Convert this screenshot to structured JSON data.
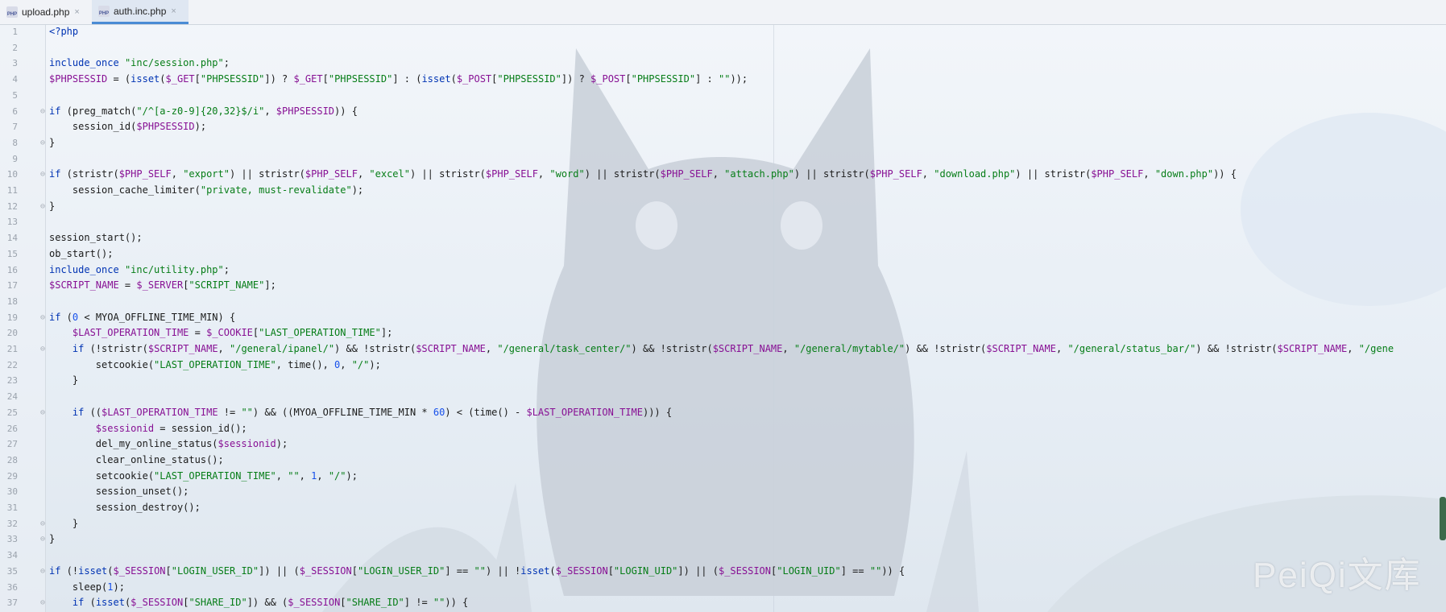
{
  "tabs": [
    {
      "label": "upload.php",
      "active": false,
      "icon": "php-file-icon"
    },
    {
      "label": "auth.inc.php",
      "active": true,
      "icon": "php-file-icon"
    }
  ],
  "icon_text": "PHP",
  "close_glyph": "×",
  "watermark": "PeiQi文库",
  "colors": {
    "keyword": "#0033b3",
    "variable": "#871094",
    "string": "#067d17",
    "number": "#1750eb",
    "tab_active_underline": "#4a8bd4"
  },
  "code_lines": [
    "<?php",
    "",
    "include_once \"inc/session.php\";",
    "$PHPSESSID = (isset($_GET[\"PHPSESSID\"]) ? $_GET[\"PHPSESSID\"] : (isset($_POST[\"PHPSESSID\"]) ? $_POST[\"PHPSESSID\"] : \"\"));",
    "",
    "if (preg_match(\"/^[a-z0-9]{20,32}$/i\", $PHPSESSID)) {",
    "    session_id($PHPSESSID);",
    "}",
    "",
    "if (stristr($PHP_SELF, \"export\") || stristr($PHP_SELF, \"excel\") || stristr($PHP_SELF, \"word\") || stristr($PHP_SELF, \"attach.php\") || stristr($PHP_SELF, \"download.php\") || stristr($PHP_SELF, \"down.php\")) {",
    "    session_cache_limiter(\"private, must-revalidate\");",
    "}",
    "",
    "session_start();",
    "ob_start();",
    "include_once \"inc/utility.php\";",
    "$SCRIPT_NAME = $_SERVER[\"SCRIPT_NAME\"];",
    "",
    "if (0 < MYOA_OFFLINE_TIME_MIN) {",
    "    $LAST_OPERATION_TIME = $_COOKIE[\"LAST_OPERATION_TIME\"];",
    "    if (!stristr($SCRIPT_NAME, \"/general/ipanel/\") && !stristr($SCRIPT_NAME, \"/general/task_center/\") && !stristr($SCRIPT_NAME, \"/general/mytable/\") && !stristr($SCRIPT_NAME, \"/general/status_bar/\") && !stristr($SCRIPT_NAME, \"/gene",
    "        setcookie(\"LAST_OPERATION_TIME\", time(), 0, \"/\");",
    "    }",
    "",
    "    if (($LAST_OPERATION_TIME != \"\") && ((MYOA_OFFLINE_TIME_MIN * 60) < (time() - $LAST_OPERATION_TIME))) {",
    "        $sessionid = session_id();",
    "        del_my_online_status($sessionid);",
    "        clear_online_status();",
    "        setcookie(\"LAST_OPERATION_TIME\", \"\", 1, \"/\");",
    "        session_unset();",
    "        session_destroy();",
    "    }",
    "}",
    "",
    "if (!isset($_SESSION[\"LOGIN_USER_ID\"]) || ($_SESSION[\"LOGIN_USER_ID\"] == \"\") || !isset($_SESSION[\"LOGIN_UID\"]) || ($_SESSION[\"LOGIN_UID\"] == \"\")) {",
    "    sleep(1);",
    "    if (isset($_SESSION[\"SHARE_ID\"]) && ($_SESSION[\"SHARE_ID\"] != \"\")) {"
  ],
  "line_numbers": [
    "1",
    "2",
    "3",
    "4",
    "5",
    "6",
    "7",
    "8",
    "9",
    "10",
    "11",
    "12",
    "13",
    "14",
    "15",
    "16",
    "17",
    "18",
    "19",
    "20",
    "21",
    "22",
    "23",
    "24",
    "25",
    "26",
    "27",
    "28",
    "29",
    "30",
    "31",
    "32",
    "33",
    "34",
    "35",
    "36",
    "37"
  ]
}
